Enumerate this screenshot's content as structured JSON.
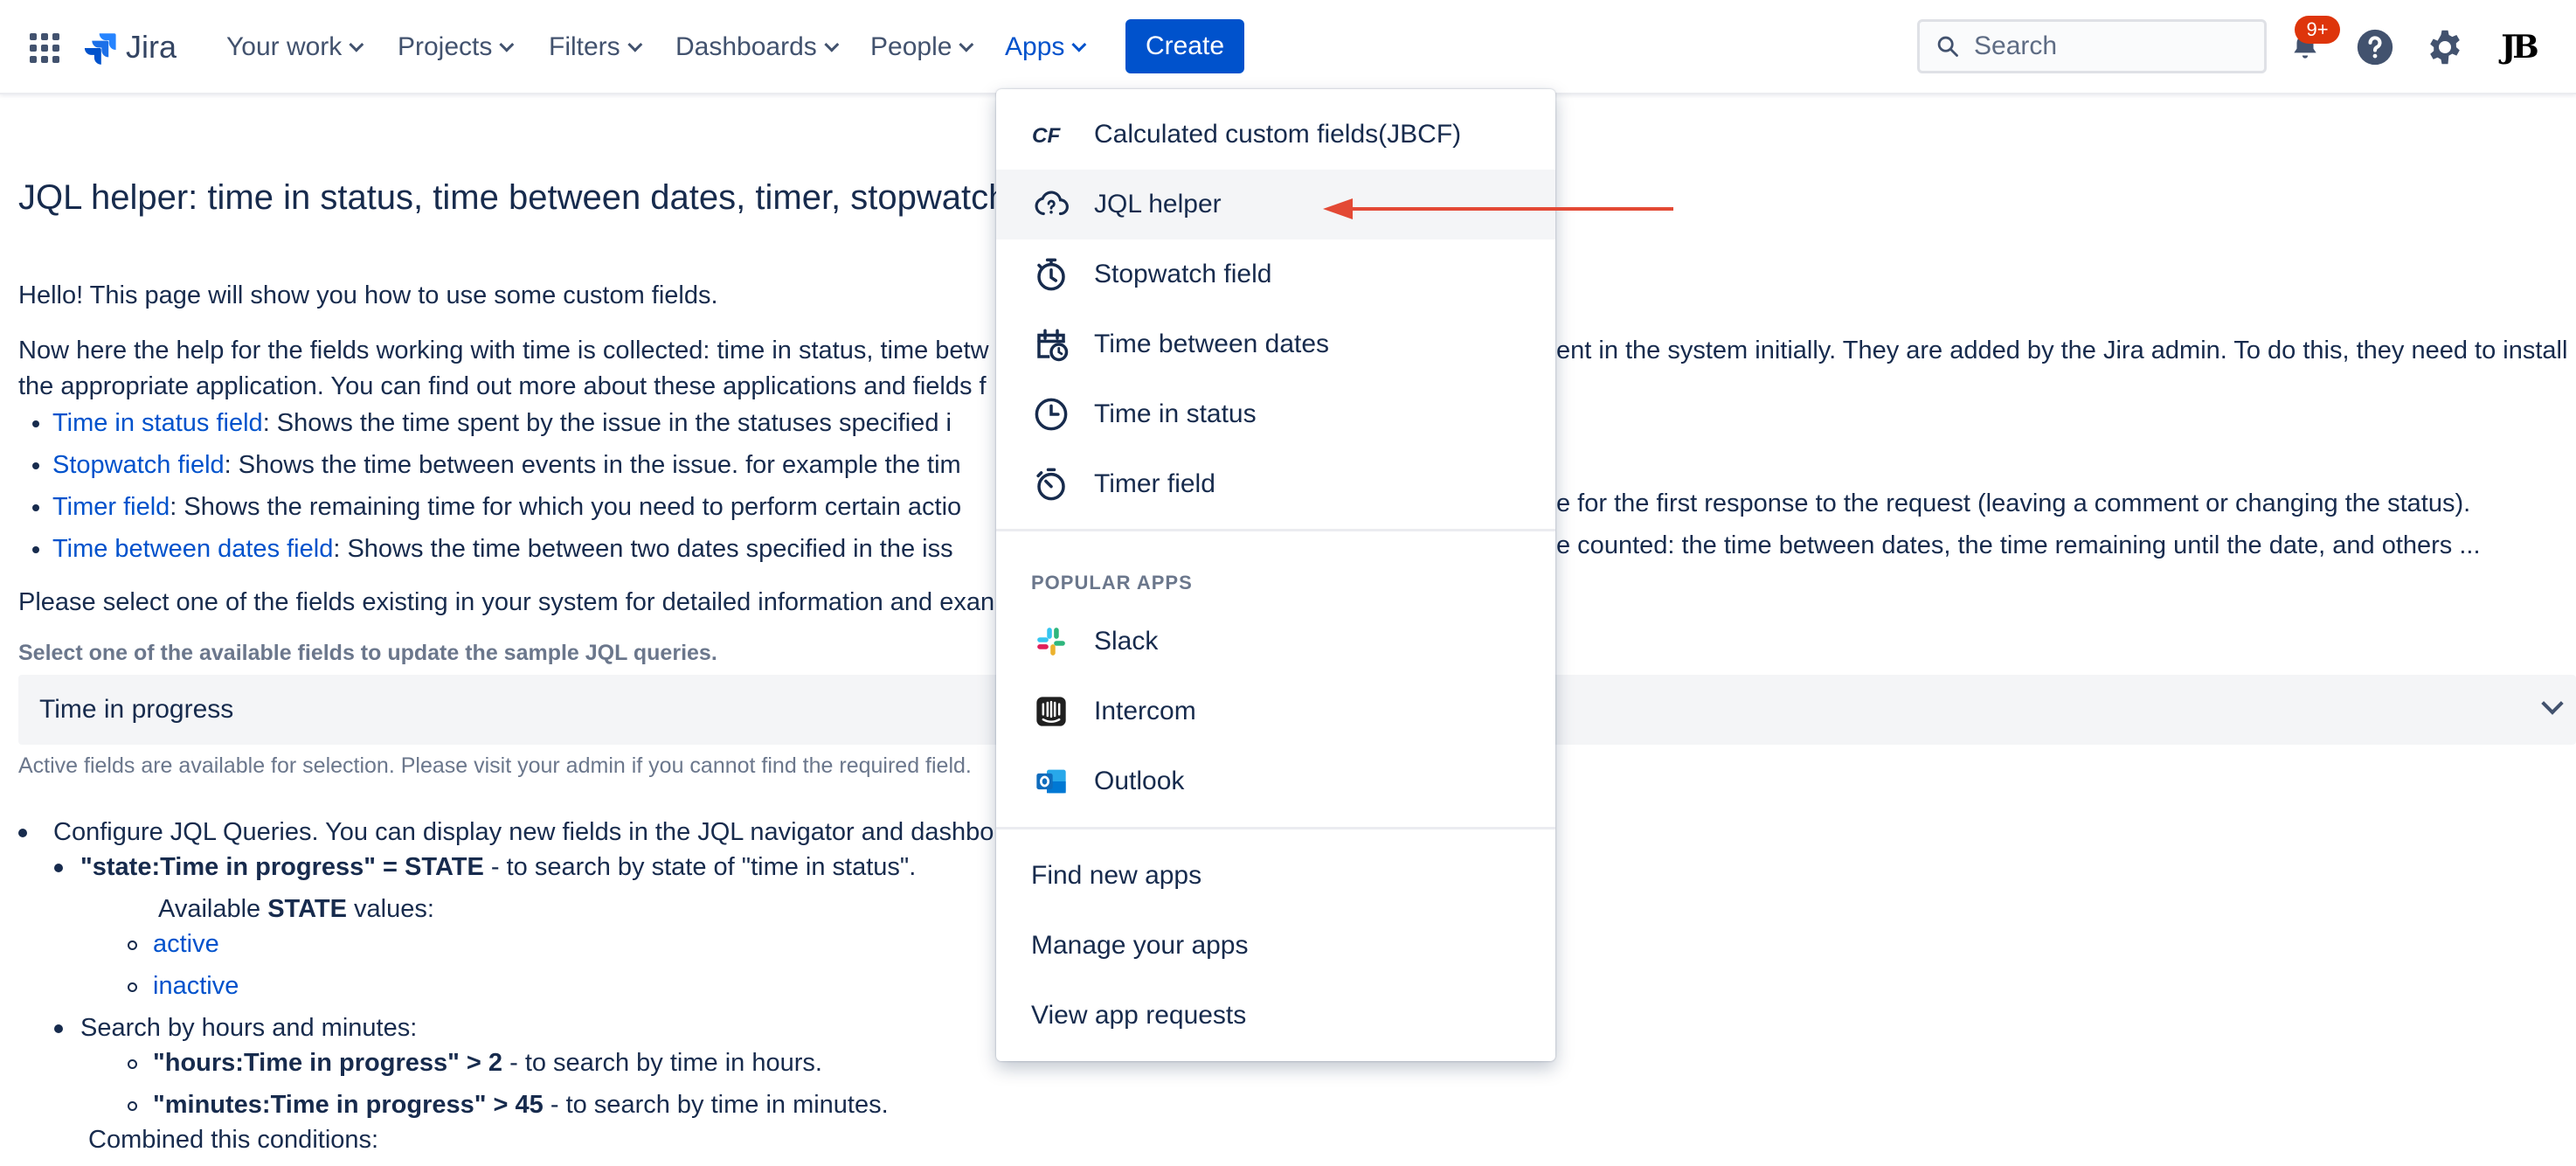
{
  "nav": {
    "logo_text": "Jira",
    "items": [
      {
        "label": "Your work"
      },
      {
        "label": "Projects"
      },
      {
        "label": "Filters"
      },
      {
        "label": "Dashboards"
      },
      {
        "label": "People"
      },
      {
        "label": "Apps"
      }
    ],
    "create_label": "Create",
    "search_placeholder": "Search",
    "notification_badge": "9+",
    "avatar_initials": "JB"
  },
  "page": {
    "title": "JQL helper: time in status, time between dates, timer, stopwatch",
    "intro": "Hello! This page will show you how to use some custom fields.",
    "para1_line1_a": "Now here the help for the fields working with time is collected: time in status, time betw",
    "para1_line1_b": "ent in the system initially. They are added by the Jira admin. To do this, they need to install",
    "para1_line2": "the appropriate application. You can find out more about these applications and fields f",
    "fields": [
      {
        "link": "Time in status field",
        "text": ": Shows the time spent by the issue in the statuses specified i",
        "tail": ""
      },
      {
        "link": "Stopwatch field",
        "text": ": Shows the time between events in the issue. for example the tim",
        "tail": ""
      },
      {
        "link": "Timer field",
        "text": ": Shows the remaining time for which you need to perform certain actio",
        "tail": "e for the first response to the request (leaving a comment or changing the status)."
      },
      {
        "link": "Time between dates field",
        "text": ": Shows the time between two dates specified in the iss",
        "tail": "e counted: the time between dates, the time remaining until the date, and others ..."
      }
    ],
    "select_prompt": "Please select one of the fields existing in your system for detailed information and exan",
    "select_label": "Select one of the available fields to update the sample JQL queries.",
    "select_value": "Time in progress",
    "select_helper": "Active fields are available for selection. Please visit your admin if you cannot find the required field.",
    "configure": "Configure JQL Queries. You can display new fields in the JQL navigator and dashbo",
    "state_query_bold": "\"state:Time in progress\" = STATE",
    "state_query_rest": " - to search by state of \"time in status\".",
    "available_prefix": "Available ",
    "available_bold": "STATE",
    "available_suffix": " values:",
    "state_values": [
      "active",
      "inactive"
    ],
    "search_hours_minutes": "Search by hours and minutes:",
    "hours_bold": "\"hours:Time in progress\" > 2",
    "hours_rest": " - to search by time in hours.",
    "minutes_bold": "\"minutes:Time in progress\" > 45",
    "minutes_rest": " - to search by time in minutes.",
    "combined": "Combined this conditions:"
  },
  "apps_menu": {
    "items": [
      {
        "label": "Calculated custom fields(JBCF)",
        "icon": "jbcf-icon"
      },
      {
        "label": "JQL helper",
        "icon": "cloud-question-icon"
      },
      {
        "label": "Stopwatch field",
        "icon": "stopwatch-icon"
      },
      {
        "label": "Time between dates",
        "icon": "calendar-clock-icon"
      },
      {
        "label": "Time in status",
        "icon": "clock-icon"
      },
      {
        "label": "Timer field",
        "icon": "timer-icon"
      }
    ],
    "popular_heading": "POPULAR APPS",
    "popular": [
      {
        "label": "Slack",
        "icon": "slack-icon"
      },
      {
        "label": "Intercom",
        "icon": "intercom-icon"
      },
      {
        "label": "Outlook",
        "icon": "outlook-icon"
      }
    ],
    "footer": [
      {
        "label": "Find new apps"
      },
      {
        "label": "Manage your apps"
      },
      {
        "label": "View app requests"
      }
    ]
  },
  "colors": {
    "accent": "#0052cc",
    "annotation_arrow": "#e34935",
    "badge": "#de350b"
  }
}
